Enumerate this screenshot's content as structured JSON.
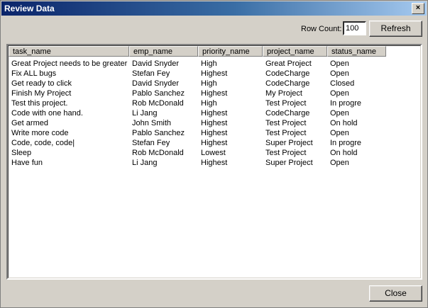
{
  "window": {
    "title": "Review Data",
    "close_glyph": "×"
  },
  "toolbar": {
    "row_count_label": "Row Count:",
    "row_count_value": "100",
    "refresh_label": "Refresh"
  },
  "grid": {
    "columns": [
      "task_name",
      "emp_name",
      "priority_name",
      "project_name",
      "status_name"
    ],
    "rows": [
      [
        "Great Project needs to be greater",
        "David Snyder",
        "High",
        "Great Project",
        "Open"
      ],
      [
        "Fix ALL bugs",
        "Stefan Fey",
        "Highest",
        "CodeCharge",
        "Open"
      ],
      [
        "Get ready to click",
        "David Snyder",
        "High",
        "CodeCharge",
        "Closed"
      ],
      [
        "Finish My Project",
        "Pablo Sanchez",
        "Highest",
        "My Project",
        "Open"
      ],
      [
        "Test this project.",
        "Rob McDonald",
        "High",
        "Test Project",
        "In progre"
      ],
      [
        "Code with one hand.",
        "Li Jang",
        "Highest",
        "CodeCharge",
        "Open"
      ],
      [
        "Get armed",
        "John Smith",
        "Highest",
        "Test Project",
        "On hold"
      ],
      [
        "Write more code",
        "Pablo Sanchez",
        "Highest",
        "Test Project",
        "Open"
      ],
      [
        "Code, code, code|",
        "Stefan Fey",
        "Highest",
        "Super Project",
        "In progre"
      ],
      [
        "Sleep",
        "Rob McDonald",
        "Lowest",
        "Test Project",
        "On hold"
      ],
      [
        "Have fun",
        "Li Jang",
        "Highest",
        "Super Project",
        "Open"
      ]
    ]
  },
  "footer": {
    "close_label": "Close"
  }
}
